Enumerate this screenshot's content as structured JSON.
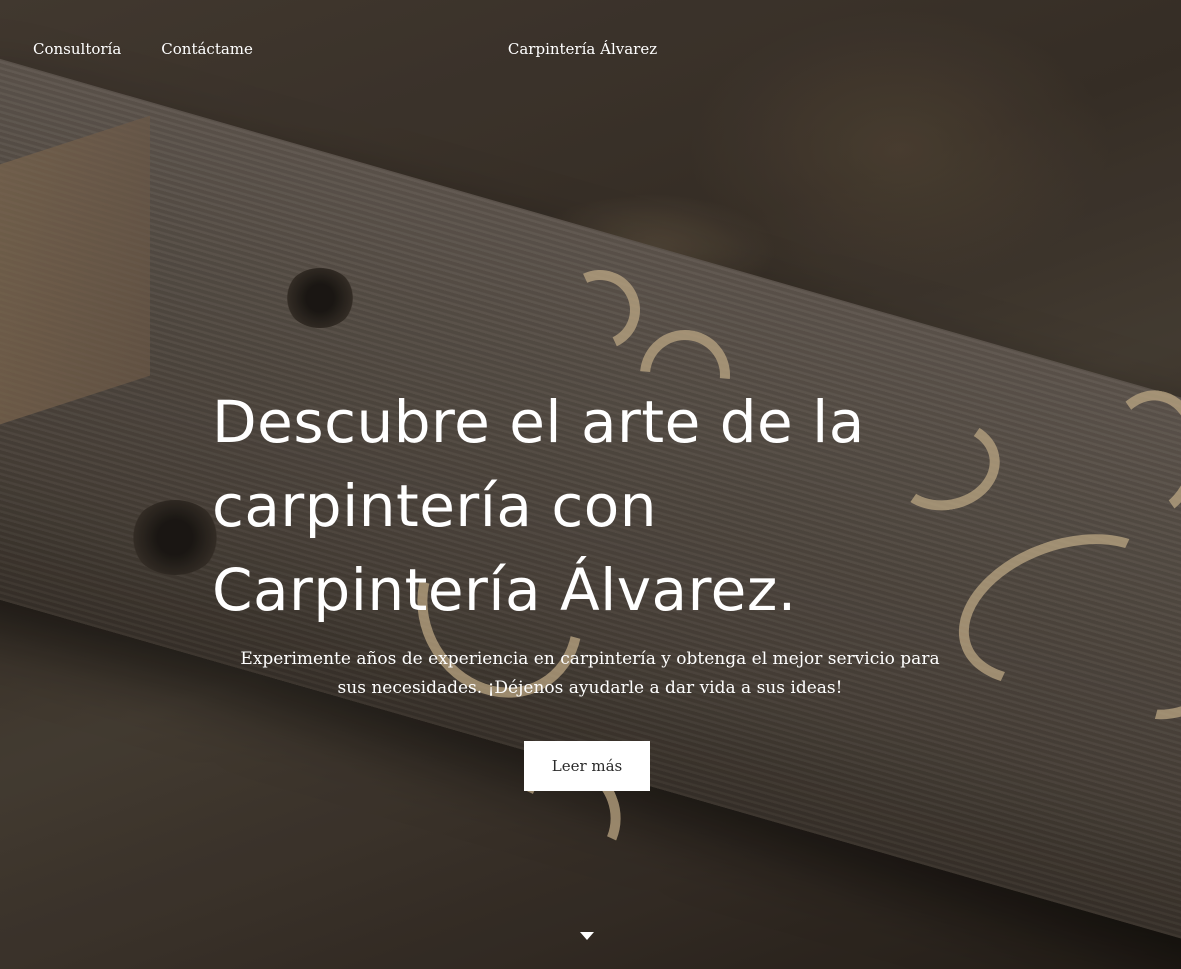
{
  "nav": {
    "items": [
      {
        "label": "Consultoría"
      },
      {
        "label": "Contáctame"
      }
    ]
  },
  "site": {
    "title": "Carpintería Álvarez"
  },
  "hero": {
    "headline": "Descubre el arte de la carpintería con Carpintería Álvarez.",
    "subtext": "Experimente años de experiencia en carpintería y obtenga el mejor servicio para sus necesidades. ¡Déjenos ayudarle a dar vida a sus ideas!",
    "cta_label": "Leer más",
    "background_image": "wood-plank-with-shavings",
    "scroll_icon": "caret-down-icon"
  },
  "colors": {
    "text": "#ffffff",
    "button_bg": "#ffffff",
    "button_text": "#2b2b2b"
  }
}
